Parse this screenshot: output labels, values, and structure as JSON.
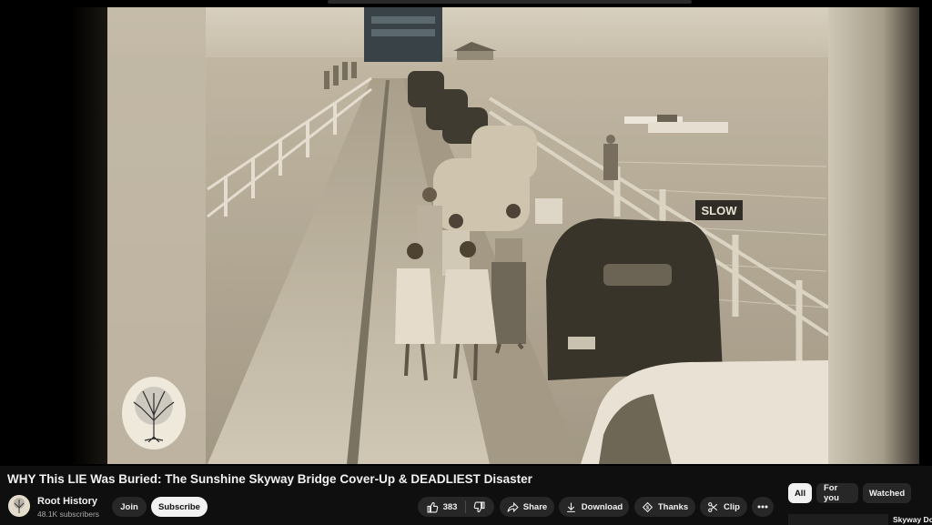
{
  "video": {
    "title": "WHY This LIE Was Buried: The Sunshine Skyway Bridge Cover-Up & DEADLIEST Disaster",
    "sign_text": "SLOW"
  },
  "channel": {
    "name": "Root History",
    "subscribers": "48.1K subscribers",
    "join_label": "Join",
    "subscribe_label": "Subscribe"
  },
  "actions": {
    "like_count": "383",
    "share_label": "Share",
    "download_label": "Download",
    "thanks_label": "Thanks",
    "clip_label": "Clip"
  },
  "chips": {
    "all": "All",
    "for_you": "For you",
    "watched": "Watched"
  },
  "next_video": {
    "title": "Skyway Dc"
  },
  "colors": {
    "background": "#0f0f0f",
    "pill": "#272727",
    "photo_tint": "#c9c0ad"
  },
  "icons": [
    "thumb-up-icon",
    "thumb-down-icon",
    "share-icon",
    "download-icon",
    "thanks-icon",
    "clip-icon",
    "more-icon",
    "tree-logo-icon"
  ]
}
